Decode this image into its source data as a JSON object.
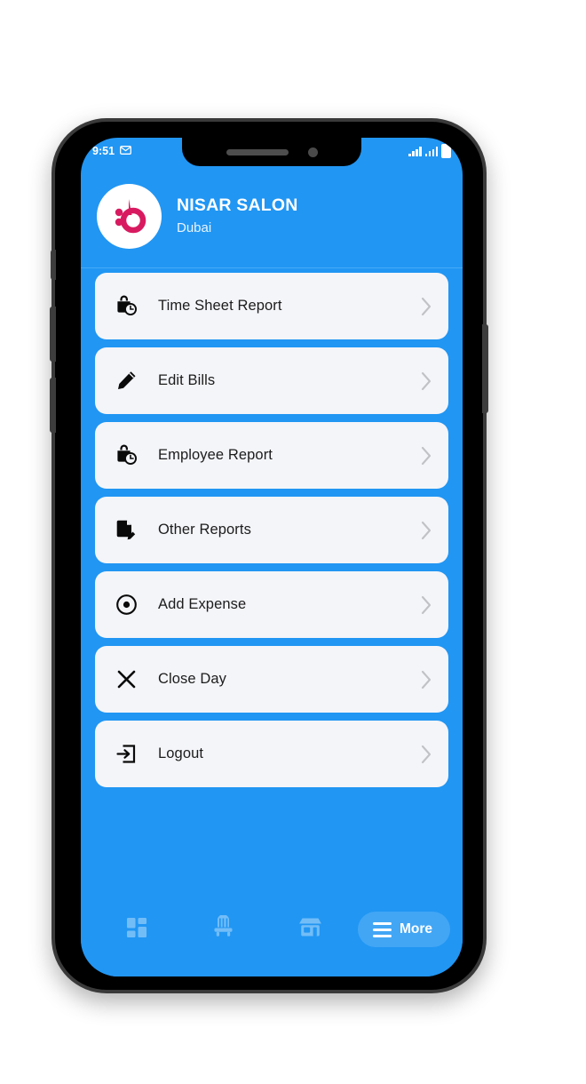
{
  "colors": {
    "screen_blue": "#2196F3",
    "nav_pill_blue": "#42a6f5",
    "card_bg": "#f4f5f9",
    "chevron_gray": "#c1c2c6",
    "logo_pink": "#d81b60",
    "text_dark": "#1c1c1c"
  },
  "status_bar": {
    "time": "9:51",
    "mail_icon": "mail-icon",
    "signal_1_icon": "signal-bars-icon",
    "signal_2_icon": "signal-bars-icon",
    "battery_icon": "battery-icon"
  },
  "header": {
    "logo_icon": "brand-logo-b",
    "shop_name": "NISAR SALON",
    "location": "Dubai"
  },
  "menu": {
    "items": [
      {
        "label": "Time Sheet Report",
        "icon": "bag-clock-icon",
        "chevron": "chevron-right-icon"
      },
      {
        "label": "Edit Bills",
        "icon": "pencil-icon",
        "chevron": "chevron-right-icon"
      },
      {
        "label": "Employee Report",
        "icon": "bag-clock-icon",
        "chevron": "chevron-right-icon"
      },
      {
        "label": "Other Reports",
        "icon": "document-edit-icon",
        "chevron": "chevron-right-icon"
      },
      {
        "label": "Add Expense",
        "icon": "record-dot-icon",
        "chevron": "chevron-right-icon"
      },
      {
        "label": "Close Day",
        "icon": "close-x-icon",
        "chevron": "chevron-right-icon"
      },
      {
        "label": "Logout",
        "icon": "logout-icon",
        "chevron": "chevron-right-icon"
      }
    ]
  },
  "bottom_nav": {
    "tabs": [
      {
        "name": "dashboard",
        "icon": "grid-dashboard-icon"
      },
      {
        "name": "chairs",
        "icon": "salon-chair-icon"
      },
      {
        "name": "shop",
        "icon": "storefront-icon"
      }
    ],
    "more": {
      "label": "More",
      "icon": "hamburger-menu-icon"
    }
  }
}
